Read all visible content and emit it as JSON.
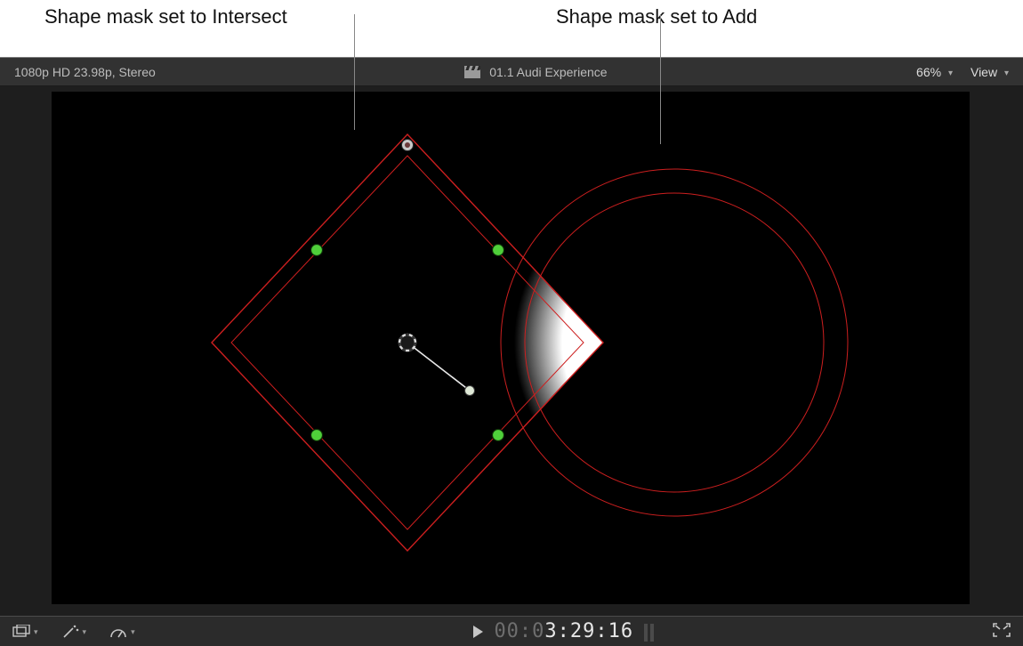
{
  "callouts": {
    "left_label": "Shape mask set to Intersect",
    "right_label": "Shape mask set to Add"
  },
  "topbar": {
    "format_text": "1080p HD 23.98p, Stereo",
    "clip_title": "01.1 Audi Experience",
    "zoom_label": "66%",
    "view_label": "View"
  },
  "bottombar": {
    "timecode_dim": "00:0",
    "timecode_bright": "3:29:16",
    "crop_icon": "crop-icon",
    "wand_icon": "retime-wand-icon",
    "speed_icon": "speed-gauge-icon",
    "play_icon": "play-icon",
    "meter_icon": "audio-meter-icon",
    "fullscreen_icon": "fullscreen-icon"
  },
  "viewer": {
    "diamond_mask_name": "shape-mask-intersect",
    "circle_mask_name": "shape-mask-add"
  }
}
